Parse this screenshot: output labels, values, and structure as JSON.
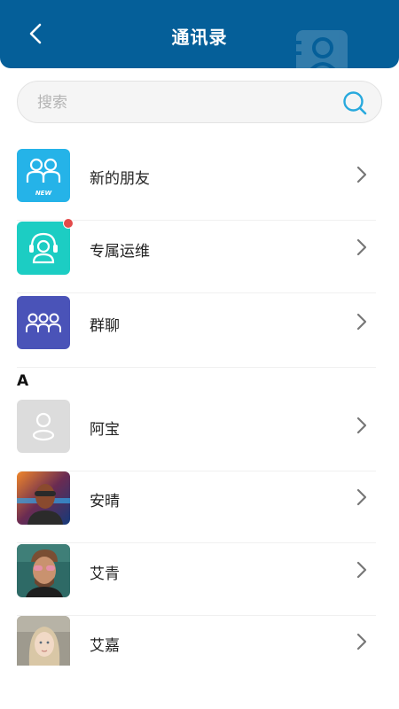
{
  "header": {
    "title": "通讯录",
    "background": "#055f99"
  },
  "search": {
    "placeholder": "搜索",
    "icon": "search-icon"
  },
  "special_items": [
    {
      "label": "新的朋友",
      "icon": "new-friends-icon",
      "icon_badge": "NEW",
      "color": "#25b3e8"
    },
    {
      "label": "专属运维",
      "icon": "support-agent-icon",
      "color": "#1ccdc3",
      "unread_dot": true,
      "dot_color": "#e34a4a"
    },
    {
      "label": "群聊",
      "icon": "group-chat-icon",
      "color": "#4a53b8"
    }
  ],
  "contacts_section": {
    "letter": "A",
    "contacts": [
      {
        "name": "阿宝",
        "avatar": "default-avatar-icon"
      },
      {
        "name": "安晴",
        "avatar": "photo-avatar"
      },
      {
        "name": "艾青",
        "avatar": "photo-avatar"
      },
      {
        "name": "艾嘉",
        "avatar": "photo-avatar"
      }
    ]
  },
  "colors": {
    "chevron": "#777777",
    "divider": "#f0f0f0"
  }
}
